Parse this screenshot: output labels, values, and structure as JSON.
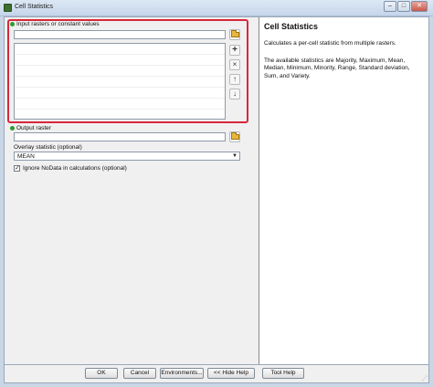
{
  "window": {
    "title": "Cell Statistics",
    "controls": {
      "minimize": "–",
      "maximize": "□",
      "close": "✕"
    }
  },
  "form": {
    "input_label": "Input rasters or constant values",
    "input_value": "",
    "input_list_items": [],
    "output_label": "Output raster",
    "output_value": "",
    "overlay_label": "Overlay statistic (optional)",
    "overlay_value": "MEAN",
    "ignore_nodata_label": "Ignore NoData in calculations (optional)",
    "ignore_nodata_checked": true,
    "side_buttons": {
      "add": "+",
      "remove": "×",
      "up": "↑",
      "down": "↓"
    }
  },
  "help": {
    "title": "Cell Statistics",
    "paragraphs": [
      "Calculates a per-cell statistic from multiple rasters.",
      "The available statistics are Majority, Maximum, Mean, Median, Minimum, Minority, Range, Standard deviation, Sum, and Variety."
    ]
  },
  "buttons": {
    "ok": "OK",
    "cancel": "Cancel",
    "environments": "Environments...",
    "hide_help": "<< Hide Help",
    "tool_help": "Tool Help"
  },
  "colors": {
    "highlight": "#d7283b",
    "required_dot": "#2f9b2f"
  }
}
